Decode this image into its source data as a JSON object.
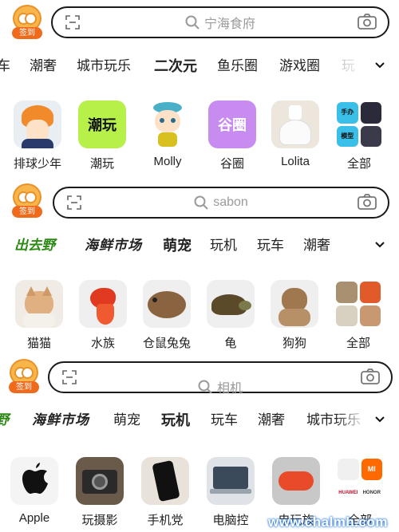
{
  "panels": [
    {
      "checkin_label": "签到",
      "search_placeholder": "宁海食府",
      "tabs": [
        "车",
        "潮奢",
        "城市玩乐",
        "二次元",
        "鱼乐圈",
        "游戏圈",
        "玩"
      ],
      "active_tab": "二次元",
      "categories": [
        {
          "label": "排球少年",
          "icon": "anime-boy-icon"
        },
        {
          "label": "潮玩",
          "icon": "chaowan-tile-icon",
          "tile_text": "潮玩",
          "tile_color": "#b8f04a"
        },
        {
          "label": "Molly",
          "icon": "molly-figure-icon"
        },
        {
          "label": "谷圈",
          "icon": "guquan-tile-icon",
          "tile_text": "谷圈",
          "tile_color": "#c88cf0"
        },
        {
          "label": "Lolita",
          "icon": "lolita-dress-icon"
        },
        {
          "label": "全部",
          "icon": "all-grid-icon",
          "mini": [
            "手办",
            "模型"
          ]
        }
      ]
    },
    {
      "checkin_label": "签到",
      "search_placeholder": "sabon",
      "tabs": [
        "出去野",
        "海鲜市场",
        "萌宠",
        "玩机",
        "玩车",
        "潮奢"
      ],
      "active_tab": "萌宠",
      "categories": [
        {
          "label": "猫猫",
          "icon": "cat-icon"
        },
        {
          "label": "水族",
          "icon": "fish-icon"
        },
        {
          "label": "仓鼠兔兔",
          "icon": "rabbit-icon"
        },
        {
          "label": "龟",
          "icon": "turtle-icon"
        },
        {
          "label": "狗狗",
          "icon": "dog-icon"
        },
        {
          "label": "全部",
          "icon": "all-grid-icon"
        }
      ]
    },
    {
      "checkin_label": "签到",
      "search_placeholder": "相机",
      "tabs": [
        "野",
        "海鲜市场",
        "萌宠",
        "玩机",
        "玩车",
        "潮奢",
        "城市玩乐"
      ],
      "active_tab": "玩机",
      "categories": [
        {
          "label": "Apple",
          "icon": "apple-logo-icon"
        },
        {
          "label": "玩摄影",
          "icon": "camera-icon"
        },
        {
          "label": "手机党",
          "icon": "phone-icon"
        },
        {
          "label": "电脑控",
          "icon": "laptop-icon"
        },
        {
          "label": "电玩族",
          "icon": "gamepad-icon"
        },
        {
          "label": "全部",
          "icon": "all-grid-icon",
          "mini": [
            "MI",
            "HUAWEI",
            "HONOR"
          ]
        }
      ]
    }
  ],
  "watermark": "www.chalmh.com",
  "colors": {
    "accent": "#f06a1c",
    "green": "#2a8a12",
    "placeholder": "#9a9a9a"
  }
}
